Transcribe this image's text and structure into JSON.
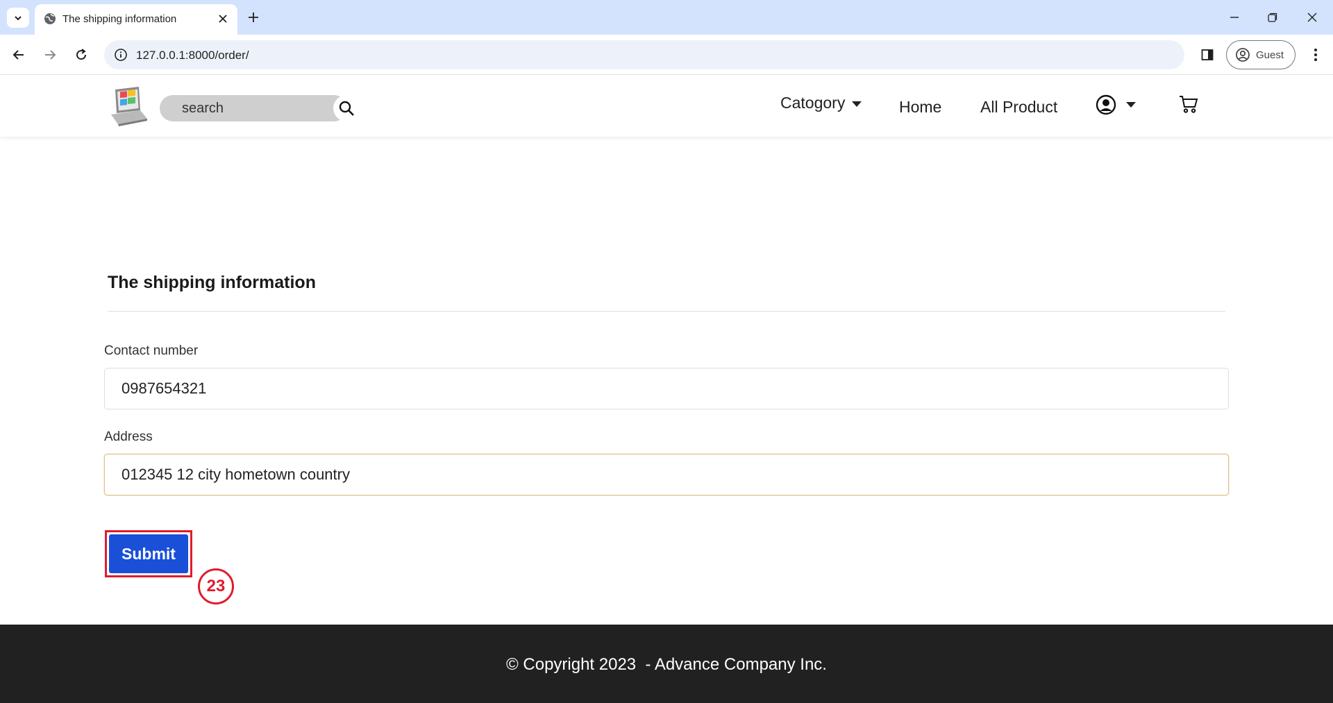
{
  "browser": {
    "tab_title": "The shipping information",
    "url": "127.0.0.1:8000/order/",
    "profile_label": "Guest"
  },
  "header": {
    "search_placeholder": "search",
    "nav": {
      "category": "Catogory",
      "home": "Home",
      "all_product": "All Product"
    }
  },
  "form": {
    "heading": "The shipping information",
    "contact_label": "Contact number",
    "contact_value": "0987654321",
    "address_label": "Address",
    "address_value": "012345 12 city hometown country",
    "submit_label": "Submit"
  },
  "annotation": {
    "step_number": "23"
  },
  "footer": {
    "copyright": "© Copyright 2023  - Advance Company Inc."
  },
  "colors": {
    "tabbar_bg": "#d3e3fd",
    "submit_bg": "#1a4fd8",
    "annotation_red": "#e01b2c",
    "footer_bg": "#212121"
  }
}
